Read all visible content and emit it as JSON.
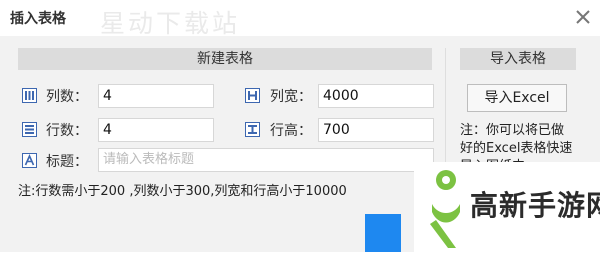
{
  "dialog": {
    "title": "插入表格",
    "watermark": "星动下载站"
  },
  "new_table": {
    "header": "新建表格",
    "columns_label": "列数：",
    "columns_value": "4",
    "col_width_label": "列宽：",
    "col_width_value": "4000",
    "rows_label": "行数：",
    "rows_value": "4",
    "row_height_label": "行高：",
    "row_height_value": "700",
    "title_label": "标题：",
    "title_placeholder": "请输入表格标题",
    "limits_note": "注:行数需小于200 ,列数小于300,列宽和行高小于10000"
  },
  "import_table": {
    "header": "导入表格",
    "button_label": "导入Excel",
    "note_line1": "注：你可以将已做",
    "note_line2": "好的Excel表格快速",
    "note_line3": "导入图纸中"
  },
  "site_logo": {
    "text": "高新手游网"
  },
  "colors": {
    "accent_blue": "#1e88f0",
    "icon_blue": "#3d67b0",
    "logo_green": "#7cc242"
  },
  "icons": [
    "close-icon",
    "columns-icon",
    "column-width-icon",
    "rows-icon",
    "row-height-icon",
    "title-icon"
  ]
}
